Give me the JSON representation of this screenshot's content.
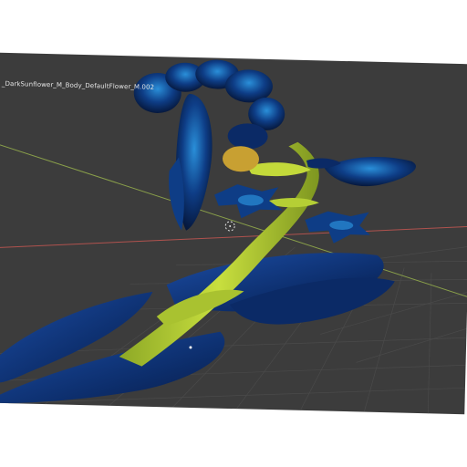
{
  "viewport": {
    "object_label": "_DarkSunflower_M_Body_DefaultFlower_M.002",
    "background_color": "#3c3c3c",
    "grid_color": "#4a4a4a",
    "x_axis_color": "#b0524e",
    "y_axis_color": "#8aa04a",
    "stem_color": "#b9d036",
    "petal_color": "#0d2f6e",
    "petal_highlight_color": "#2a8fd9"
  },
  "icons": {
    "cursor": "3d-cursor-icon",
    "origin": "object-origin-icon"
  }
}
